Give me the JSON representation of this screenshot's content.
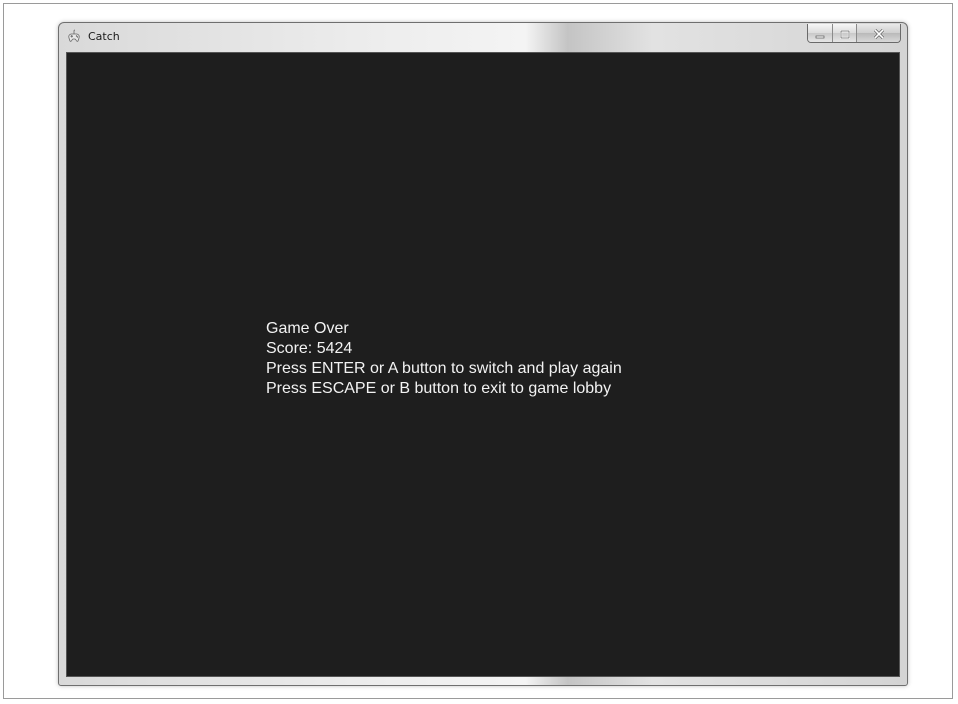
{
  "window": {
    "title": "Catch",
    "icon": "gamepad-icon",
    "caption_buttons": {
      "minimize_icon": "minimize-icon",
      "maximize_icon": "maximize-icon",
      "close_icon": "close-icon"
    }
  },
  "game": {
    "status": "Game Over",
    "score_line": "Score: 5424",
    "enter_instruction": "Press ENTER or A button to switch and play again",
    "escape_instruction": "Press ESCAPE or B button to exit to game lobby",
    "background_color": "#1e1e1e",
    "text_color": "#f2f2f2"
  }
}
